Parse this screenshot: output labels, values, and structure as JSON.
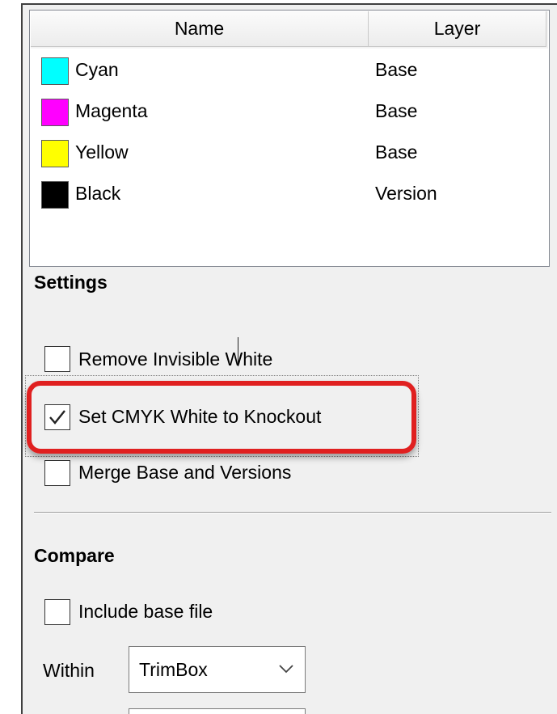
{
  "list": {
    "headers": {
      "name": "Name",
      "layer": "Layer"
    },
    "rows": [
      {
        "name": "Cyan",
        "layer": "Base",
        "color": "#00ffff"
      },
      {
        "name": "Magenta",
        "layer": "Base",
        "color": "#ff00ff"
      },
      {
        "name": "Yellow",
        "layer": "Base",
        "color": "#ffff00"
      },
      {
        "name": "Black",
        "layer": "Version",
        "color": "#000000"
      }
    ]
  },
  "settings": {
    "title": "Settings",
    "options": [
      {
        "label": "Remove Invisible White",
        "checked": false
      },
      {
        "label": "Set CMYK White to Knockout",
        "checked": true,
        "highlighted": true
      },
      {
        "label": "Merge Base and Versions",
        "checked": false
      }
    ]
  },
  "compare": {
    "title": "Compare",
    "include_base_label": "Include base file",
    "include_base_checked": false,
    "within_label": "Within",
    "within_value": "TrimBox"
  },
  "colors": {
    "highlight": "#e02020",
    "panel_bg": "#f0f0f0"
  }
}
